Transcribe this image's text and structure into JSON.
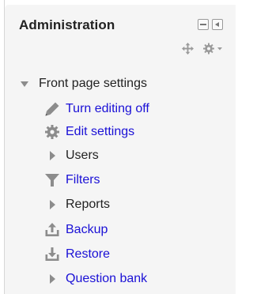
{
  "block": {
    "title": "Administration",
    "controls": {
      "hide_icon": "square-minus-icon",
      "dock_icon": "dock-left-icon",
      "move_icon": "move-arrows-icon",
      "actions_icon": "gear-menu-icon"
    }
  },
  "tree": {
    "root_label": "Front page settings",
    "items": [
      {
        "label": "Turn editing off",
        "type": "link",
        "icon": "pencil-icon"
      },
      {
        "label": "Edit settings",
        "type": "link",
        "icon": "gear-icon"
      },
      {
        "label": "Users",
        "type": "branch",
        "icon": "chevron-right-icon"
      },
      {
        "label": "Filters",
        "type": "link",
        "icon": "filter-icon"
      },
      {
        "label": "Reports",
        "type": "branch",
        "icon": "chevron-right-icon"
      },
      {
        "label": "Backup",
        "type": "link",
        "icon": "upload-icon"
      },
      {
        "label": "Restore",
        "type": "link",
        "icon": "download-icon"
      },
      {
        "label": "Question bank",
        "type": "branch-link",
        "icon": "chevron-right-icon"
      }
    ]
  },
  "colors": {
    "link": "#1a10d6",
    "text": "#222222",
    "icon": "#8c8c8c",
    "block_bg": "#f5f5f5"
  }
}
